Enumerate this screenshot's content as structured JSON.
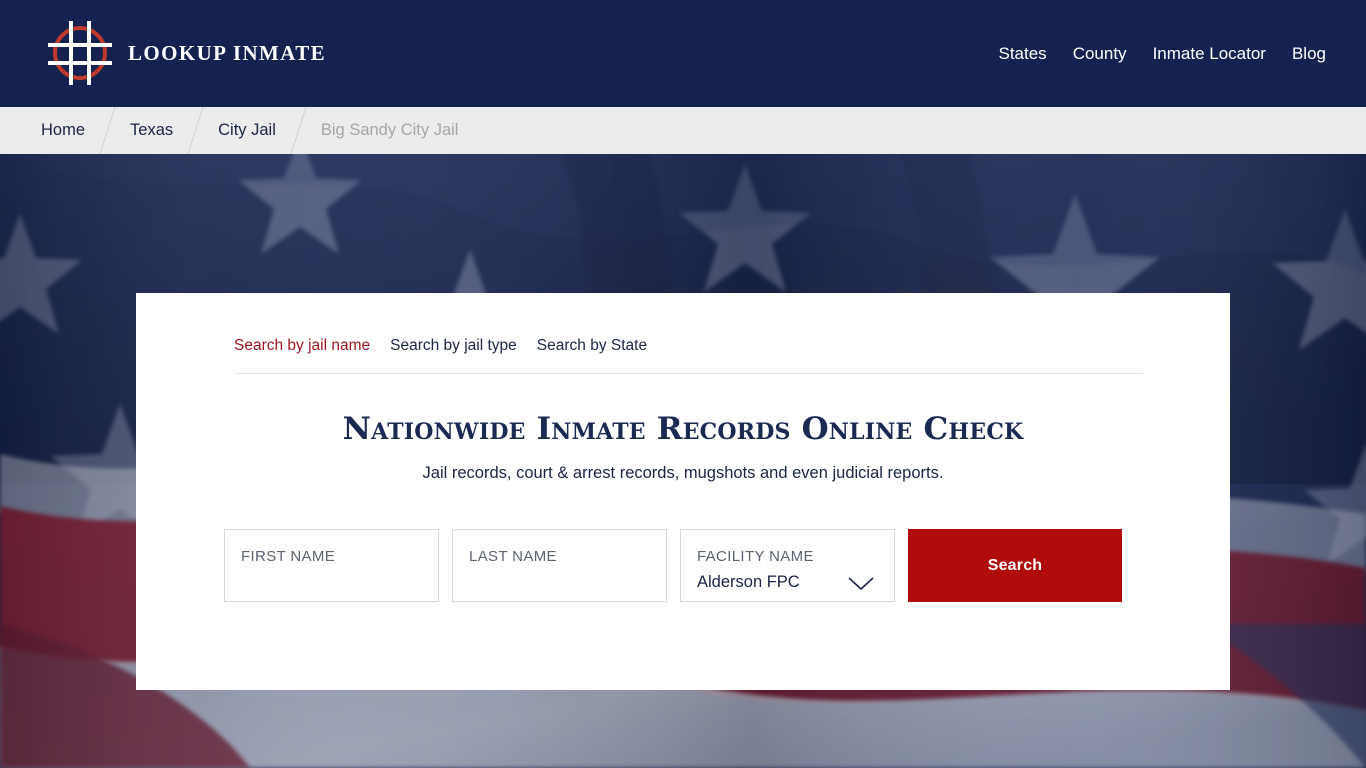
{
  "header": {
    "brand_name": "LOOKUP INMATE",
    "logo_icon": "crosshair-target-icon",
    "nav_items": [
      {
        "label": "States"
      },
      {
        "label": "County"
      },
      {
        "label": "Inmate Locator"
      },
      {
        "label": "Blog"
      }
    ]
  },
  "breadcrumb": {
    "items": [
      {
        "label": "Home",
        "current": false
      },
      {
        "label": "Texas",
        "current": false
      },
      {
        "label": "City Jail",
        "current": false
      },
      {
        "label": "Big Sandy City Jail",
        "current": true
      }
    ]
  },
  "search_card": {
    "tabs": [
      {
        "label": "Search by jail name",
        "active": true
      },
      {
        "label": "Search by jail type",
        "active": false
      },
      {
        "label": "Search by State",
        "active": false
      }
    ],
    "title": "Nationwide Inmate Records Online Check",
    "subtitle": "Jail records, court & arrest records, mugshots and even judicial reports.",
    "fields": {
      "first_name": {
        "label": "FIRST NAME",
        "value": ""
      },
      "last_name": {
        "label": "LAST NAME",
        "value": ""
      },
      "facility_name": {
        "label": "FACILITY NAME",
        "value": "Alderson FPC",
        "chevron_icon": "chevron-down-icon"
      }
    },
    "search_button_label": "Search"
  },
  "colors": {
    "header_navy": "#152250",
    "breadcrumb_bar": "#ececec",
    "accent_red": "#b00c0c",
    "tab_active_red": "#a01621",
    "title_navy": "#1b2a52",
    "card_background": "#ffffff",
    "field_border": "#d6d6d6"
  },
  "background": {
    "image": "american-flag-photo"
  }
}
